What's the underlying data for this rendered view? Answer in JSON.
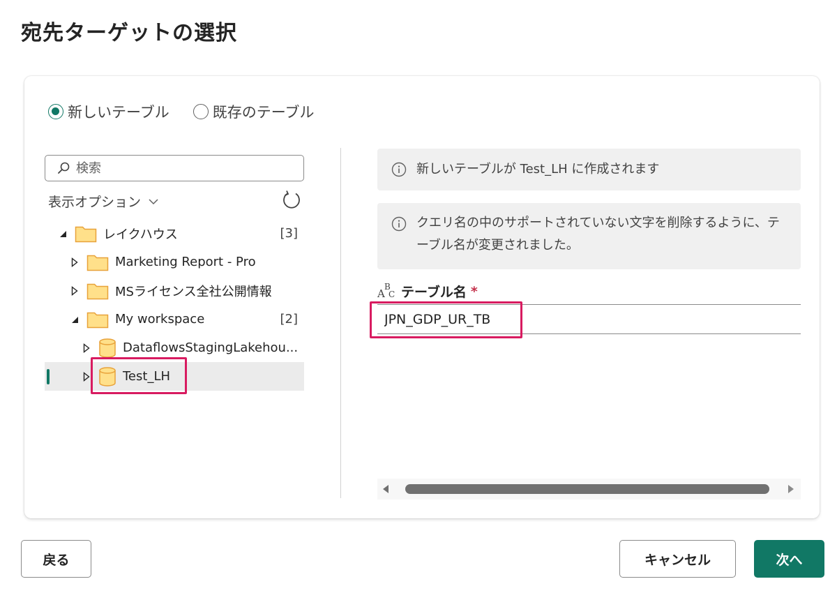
{
  "dialog": {
    "title": "宛先ターゲットの選択"
  },
  "radios": [
    {
      "label": "新しいテーブル",
      "checked": true
    },
    {
      "label": "既存のテーブル",
      "checked": false
    }
  ],
  "left": {
    "search_placeholder": "検索",
    "view_options_label": "表示オプション",
    "tree": [
      {
        "label": "レイクハウス",
        "count": "[3]",
        "type": "folder",
        "expanded": true,
        "level": 0
      },
      {
        "label": "Marketing Report - Pro",
        "count": "",
        "type": "folder",
        "expanded": false,
        "level": 1
      },
      {
        "label": "MSライセンス全社公開情報",
        "count": "",
        "type": "folder",
        "expanded": false,
        "level": 1
      },
      {
        "label": "My workspace",
        "count": "[2]",
        "type": "folder",
        "expanded": true,
        "level": 1
      },
      {
        "label": "DataflowsStagingLakehou...",
        "count": "",
        "type": "lakehouse",
        "expanded": false,
        "level": 2
      },
      {
        "label": "Test_LH",
        "count": "",
        "type": "lakehouse",
        "expanded": false,
        "level": 2,
        "selected": true
      }
    ]
  },
  "right": {
    "info_messages": [
      "新しいテーブルが Test_LH に作成されます",
      "クエリ名の中のサポートされていない文字を削除するように、テーブル名が変更されました。"
    ],
    "field_label": "テーブル名",
    "required_marker": "*",
    "table_name_value": "JPN_GDP_UR_TB",
    "abc_icon_text": [
      "A",
      "B",
      "C"
    ]
  },
  "footer": {
    "back_label": "戻る",
    "cancel_label": "キャンセル",
    "next_label": "次へ"
  },
  "colors": {
    "accent": "#117865",
    "highlight": "#d81b60",
    "required": "#c4314b",
    "folder_fill": "#ffe08a",
    "folder_stroke": "#e8a23a"
  }
}
